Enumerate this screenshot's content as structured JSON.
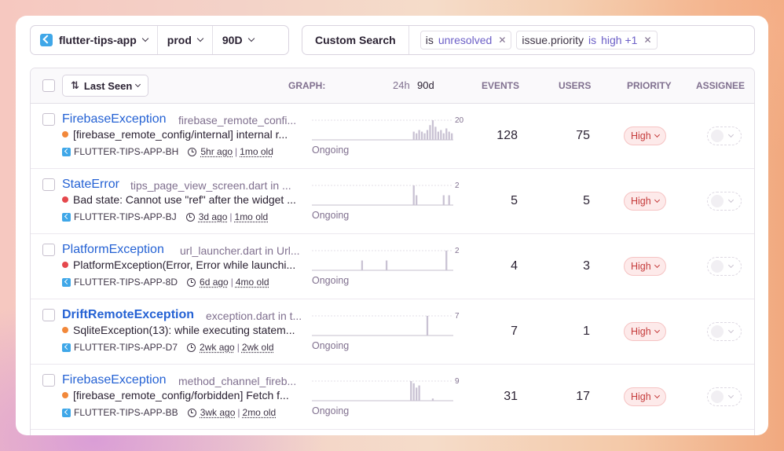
{
  "selector": {
    "project": "flutter-tips-app",
    "environment": "prod",
    "period": "90D"
  },
  "search": {
    "label": "Custom Search",
    "tokens": [
      {
        "key": "is",
        "op": "",
        "value": "unresolved"
      },
      {
        "key": "issue.priority",
        "op": "is",
        "value": "high +1"
      }
    ]
  },
  "table": {
    "sort_label": "Last Seen",
    "headers": {
      "graph": "GRAPH:",
      "period_24h": "24h",
      "period_90d": "90d",
      "events": "EVENTS",
      "users": "USERS",
      "priority": "PRIORITY",
      "assignee": "ASSIGNEE"
    },
    "rows": [
      {
        "title": "FirebaseException",
        "bold": false,
        "culprit": "firebase_remote_confi...",
        "message": "[firebase_remote_config/internal] internal r...",
        "level_color": "#f2883a",
        "short_id": "FLUTTER-TIPS-APP-BH",
        "last_seen": "5hr ago",
        "first_seen": "1mo old",
        "graph_max": "20",
        "graph": [
          0,
          0,
          0,
          0,
          0,
          0,
          0,
          0,
          0,
          0,
          0,
          0,
          0,
          0,
          0,
          0,
          0,
          0,
          0,
          0,
          0,
          0,
          0,
          0,
          0,
          0,
          0,
          0,
          0,
          0,
          0,
          0,
          0,
          0,
          0,
          0,
          0,
          5,
          4,
          6,
          5,
          4,
          6,
          9,
          12,
          8,
          5,
          6,
          4,
          7,
          5,
          4
        ],
        "status": "Ongoing",
        "events": "128",
        "users": "75",
        "priority": "High"
      },
      {
        "title": "StateError",
        "bold": false,
        "culprit": "tips_page_view_screen.dart in ...",
        "message": "Bad state: Cannot use \"ref\" after the widget ...",
        "level_color": "#e5484d",
        "short_id": "FLUTTER-TIPS-APP-BJ",
        "last_seen": "3d ago",
        "first_seen": "1mo old",
        "graph_max": "2",
        "graph": [
          0,
          0,
          0,
          0,
          0,
          0,
          0,
          0,
          0,
          0,
          0,
          0,
          0,
          0,
          0,
          0,
          0,
          0,
          0,
          0,
          0,
          0,
          0,
          0,
          0,
          0,
          0,
          0,
          0,
          0,
          0,
          0,
          0,
          0,
          0,
          0,
          0,
          2,
          1,
          0,
          0,
          0,
          0,
          0,
          0,
          0,
          0,
          0,
          1,
          0,
          1,
          0
        ],
        "status": "Ongoing",
        "events": "5",
        "users": "5",
        "priority": "High"
      },
      {
        "title": "PlatformException",
        "bold": false,
        "culprit": "url_launcher.dart in Url...",
        "message": "PlatformException(Error, Error while launchi...",
        "level_color": "#e5484d",
        "short_id": "FLUTTER-TIPS-APP-8D",
        "last_seen": "6d ago",
        "first_seen": "4mo old",
        "graph_max": "2",
        "graph": [
          0,
          0,
          0,
          0,
          0,
          0,
          0,
          0,
          0,
          0,
          0,
          0,
          0,
          0,
          0,
          0,
          0,
          0,
          1,
          0,
          0,
          0,
          0,
          0,
          0,
          0,
          0,
          1,
          0,
          0,
          0,
          0,
          0,
          0,
          0,
          0,
          0,
          0,
          0,
          0,
          0,
          0,
          0,
          0,
          0,
          0,
          0,
          0,
          0,
          2,
          0,
          0
        ],
        "status": "Ongoing",
        "events": "4",
        "users": "3",
        "priority": "High"
      },
      {
        "title": "DriftRemoteException",
        "bold": true,
        "culprit": "exception.dart in t...",
        "message": "SqliteException(13): while executing statem...",
        "level_color": "#f2883a",
        "short_id": "FLUTTER-TIPS-APP-D7",
        "last_seen": "2wk ago",
        "first_seen": "2wk old",
        "graph_max": "7",
        "graph": [
          0,
          0,
          0,
          0,
          0,
          0,
          0,
          0,
          0,
          0,
          0,
          0,
          0,
          0,
          0,
          0,
          0,
          0,
          0,
          0,
          0,
          0,
          0,
          0,
          0,
          0,
          0,
          0,
          0,
          0,
          0,
          0,
          0,
          0,
          0,
          0,
          0,
          0,
          0,
          0,
          0,
          0,
          7,
          0,
          0,
          0,
          0,
          0,
          0,
          0,
          0,
          0
        ],
        "status": "Ongoing",
        "events": "7",
        "users": "1",
        "priority": "High"
      },
      {
        "title": "FirebaseException",
        "bold": false,
        "culprit": "method_channel_fireb...",
        "message": "[firebase_remote_config/forbidden] Fetch f...",
        "level_color": "#f2883a",
        "short_id": "FLUTTER-TIPS-APP-BB",
        "last_seen": "3wk ago",
        "first_seen": "2mo old",
        "graph_max": "9",
        "graph": [
          0,
          0,
          0,
          0,
          0,
          0,
          0,
          0,
          0,
          0,
          0,
          0,
          0,
          0,
          0,
          0,
          0,
          0,
          0,
          0,
          0,
          0,
          0,
          0,
          0,
          0,
          0,
          0,
          0,
          0,
          0,
          0,
          0,
          0,
          0,
          0,
          9,
          8,
          6,
          7,
          0,
          0,
          0,
          0,
          1,
          0,
          0,
          0,
          0,
          0,
          0,
          0
        ],
        "status": "Ongoing",
        "events": "31",
        "users": "17",
        "priority": "High"
      }
    ]
  }
}
